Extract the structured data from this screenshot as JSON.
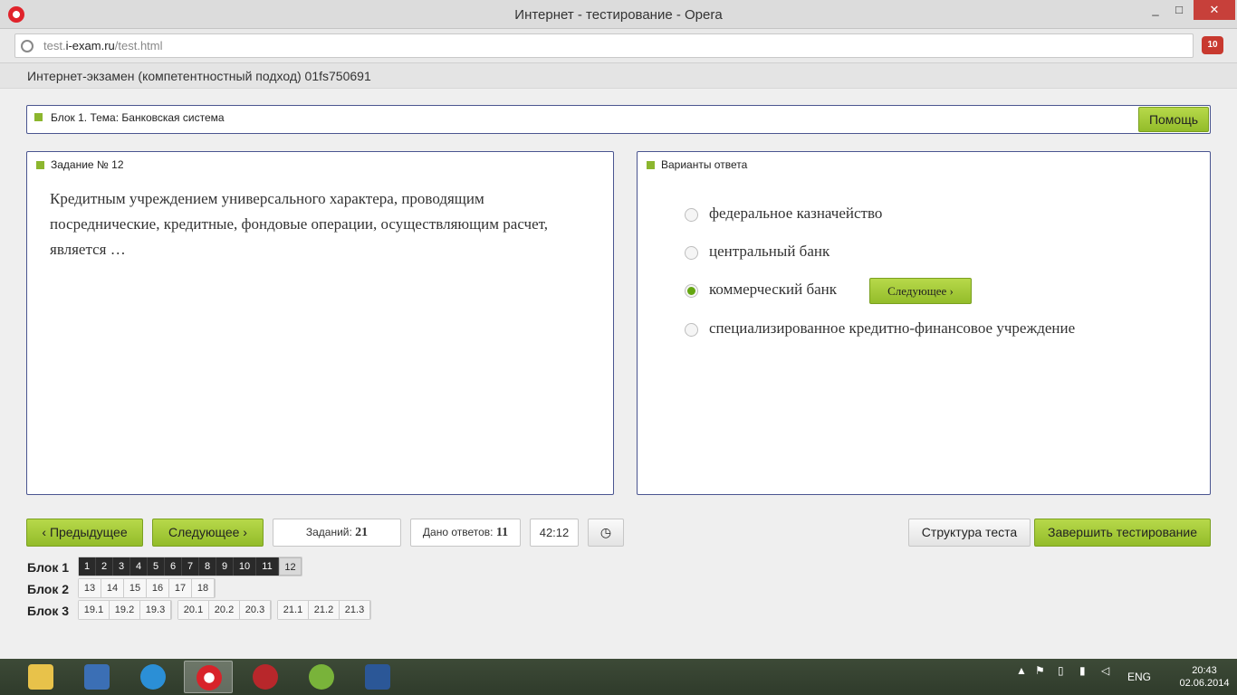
{
  "window": {
    "title": "Интернет - тестирование - Opera",
    "min": "_",
    "max": "□",
    "close": "✕"
  },
  "address": {
    "url_prefix": "test.",
    "url_domain": "i-exam.ru",
    "url_path": "/test.html",
    "ext_badge": "10"
  },
  "header": {
    "title": "Интернет-экзамен (компетентностный подход) 01fs750691"
  },
  "block": {
    "label": "Блок 1. Тема: Банковская система",
    "help": "Помощь"
  },
  "task": {
    "label": "Задание № 12",
    "text": "Кредитным учреждением универсального характера, проводящим посреднические, кредитные, фондовые операции, осуществляющим расчет, является …"
  },
  "answers": {
    "label": "Варианты ответа",
    "options": [
      {
        "text": "федеральное казначейство",
        "checked": false
      },
      {
        "text": "центральный банк",
        "checked": false
      },
      {
        "text": "коммерческий банк",
        "checked": true
      },
      {
        "text": "специализированное кредитно-финансовое учреждение",
        "checked": false
      }
    ],
    "next_inline": "Следующее"
  },
  "controls": {
    "prev": "Предыдущее",
    "next": "Следующее",
    "tasks_label": "Заданий:",
    "tasks_value": "21",
    "answered_label": "Дано ответов:",
    "answered_value": "11",
    "timer": "42:12",
    "structure": "Структура теста",
    "finish": "Завершить тестирование"
  },
  "blocks": [
    {
      "label": "Блок 1",
      "groups": [
        [
          "1",
          "2",
          "3",
          "4",
          "5",
          "6",
          "7",
          "8",
          "9",
          "10",
          "11",
          "12"
        ]
      ]
    },
    {
      "label": "Блок 2",
      "groups": [
        [
          "13",
          "14",
          "15",
          "16",
          "17",
          "18"
        ]
      ]
    },
    {
      "label": "Блок 3",
      "groups": [
        [
          "19.1",
          "19.2",
          "19.3"
        ],
        [
          "20.1",
          "20.2",
          "20.3"
        ],
        [
          "21.1",
          "21.2",
          "21.3"
        ]
      ]
    }
  ],
  "taskbar": {
    "lang": "ENG",
    "time": "20:43",
    "date": "02.06.2014",
    "apps": [
      "file-explorer",
      "control-panel",
      "browser-updater",
      "opera",
      "power-off",
      "utorrent",
      "word"
    ]
  }
}
